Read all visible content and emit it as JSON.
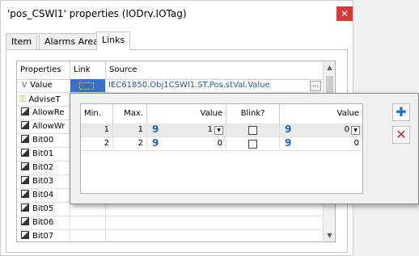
{
  "window": {
    "title": "'pos_CSWI1' properties (IODrv.IOTag)",
    "close_glyph": "✕"
  },
  "tabs": [
    {
      "label": "Item"
    },
    {
      "label": "Alarms Area"
    },
    {
      "label": "Links"
    }
  ],
  "properties_grid": {
    "headers": {
      "properties": "Properties",
      "link": "Link",
      "source": "Source"
    },
    "rows": [
      {
        "name": "Value",
        "icon": "value-v-icon",
        "source": "IEC61850.Obj1CSWI1.ST.Pos.stVal.Value",
        "has_link": true
      },
      {
        "name": "AdviseT",
        "icon": "advise-icon",
        "source": ""
      },
      {
        "name": "AllowRe",
        "icon": "bool-icon",
        "source": ""
      },
      {
        "name": "AllowWr",
        "icon": "bool-icon",
        "source": ""
      },
      {
        "name": "Bit00",
        "icon": "bool-icon",
        "source": ""
      },
      {
        "name": "Bit01",
        "icon": "bool-icon",
        "source": ""
      },
      {
        "name": "Bit02",
        "icon": "bool-icon",
        "source": ""
      },
      {
        "name": "Bit03",
        "icon": "bool-icon",
        "source": ""
      },
      {
        "name": "Bit04",
        "icon": "bool-icon",
        "source": ""
      },
      {
        "name": "Bit05",
        "icon": "bool-icon",
        "source": ""
      },
      {
        "name": "Bit06",
        "icon": "bool-icon",
        "source": ""
      },
      {
        "name": "Bit07",
        "icon": "bool-icon",
        "source": ""
      }
    ],
    "ellipsis": "..."
  },
  "conversion_popup": {
    "headers": {
      "min": "Min.",
      "max": "Max.",
      "value": "Value",
      "blink": "Blink?",
      "value2": "Value"
    },
    "rows": [
      {
        "min": "1",
        "max": "1",
        "value": "1",
        "blink": false,
        "value2": "0"
      },
      {
        "min": "2",
        "max": "2",
        "value": "0",
        "blink": false,
        "value2": "0"
      }
    ],
    "type_glyph": "9",
    "add_glyph": "✚",
    "delete_glyph": "✕",
    "colors": {
      "add": "#1f6fd1",
      "delete": "#c62828",
      "value_icon": "#1d5ec8"
    }
  }
}
